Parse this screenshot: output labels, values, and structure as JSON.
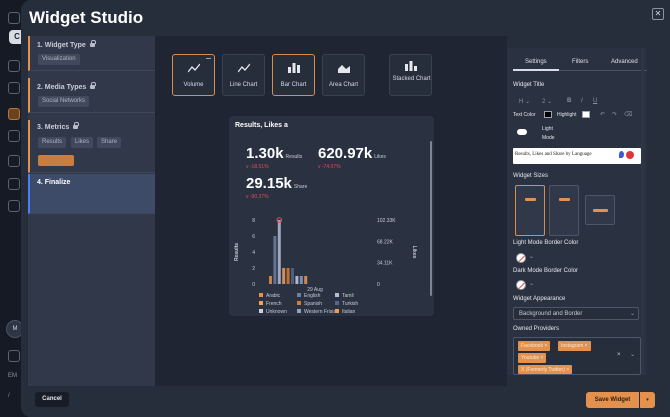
{
  "background_app": {
    "chip_letter": "C",
    "avatar_initials": "M",
    "footer_hint": "EM",
    "footer_hint2": "/"
  },
  "modal": {
    "title": "Widget Studio",
    "close_icon": "close-icon"
  },
  "steps": [
    {
      "title": "1. Widget Type",
      "locked": true,
      "tags": [
        "Visualization"
      ]
    },
    {
      "title": "2. Media Types",
      "locked": true,
      "tags": [
        "Social Networks"
      ]
    },
    {
      "title": "3. Metrics",
      "locked": true,
      "tags": [
        "Results",
        "Likes",
        "Share"
      ],
      "extra_tag": "Followers"
    },
    {
      "title": "4. Finalize",
      "locked": false,
      "tags": []
    }
  ],
  "chart_types": [
    {
      "label": "Volume",
      "icon": "line-chart-icon",
      "selected": true
    },
    {
      "label": "Line Chart",
      "icon": "line-chart-icon",
      "selected": false
    },
    {
      "label": "Bar Chart",
      "icon": "bar-chart-icon",
      "selected": true
    },
    {
      "label": "Area Chart",
      "icon": "area-chart-icon",
      "selected": false
    },
    {
      "label": "Stacked Chart",
      "icon": "stacked-chart-icon",
      "selected": false
    }
  ],
  "preview": {
    "title": "Results, Likes a",
    "metrics": [
      {
        "value": "1.30k",
        "label": "Results",
        "change": "v -18.51%"
      },
      {
        "value": "620.97k",
        "label": "Likes",
        "change": "v -74.07%"
      },
      {
        "value": "29.15k",
        "label": "Share",
        "change": "v -90.37%"
      }
    ],
    "legend": [
      "Arabic",
      "English",
      "Tamil",
      "French",
      "Spanish",
      "Turkish",
      "Unknown",
      "Western Frisian",
      "Italian"
    ],
    "legend_colors": [
      "#e3914d",
      "#6c7fa6",
      "#b3bdd6",
      "#f0a15c",
      "#d97b34",
      "#51678f",
      "#c7cfe0",
      "#8fa1c2",
      "#ee9b4f"
    ]
  },
  "chart_data": {
    "type": "bar",
    "title": "",
    "xlabel": "",
    "ylabel": "Results",
    "y2label": "Likes",
    "categories": [
      "29 Aug"
    ],
    "left_ticks": [
      "0",
      "2",
      "4",
      "6",
      "8"
    ],
    "right_ticks": [
      "0",
      "34.11K",
      "68.22K",
      "102.33K"
    ],
    "ylim": [
      0,
      8
    ],
    "y2lim": [
      0,
      102330
    ],
    "series": [
      {
        "name": "Arabic",
        "values": [
          1
        ]
      },
      {
        "name": "English",
        "values": [
          6
        ]
      },
      {
        "name": "Tamil",
        "values": [
          8
        ]
      },
      {
        "name": "French",
        "values": [
          2
        ]
      },
      {
        "name": "Spanish",
        "values": [
          2
        ]
      },
      {
        "name": "Turkish",
        "values": [
          2
        ]
      },
      {
        "name": "Unknown",
        "values": [
          1
        ]
      },
      {
        "name": "Western Frisian",
        "values": [
          1
        ]
      },
      {
        "name": "Italian",
        "values": [
          1
        ]
      }
    ]
  },
  "settings": {
    "tabs": [
      "Settings",
      "Filters",
      "Advanced"
    ],
    "active_tab": "Settings",
    "widget_title_label": "Widget Title",
    "toolbar": {
      "heading": "H",
      "size": "2",
      "bold": "B",
      "italic": "I",
      "underline": "U"
    },
    "text_color_label": "Text Color",
    "highlight_label": "Highlight",
    "light_mode_label": "Light Mode",
    "title_value": "Results, Likes and Share by Language",
    "widget_sizes_label": "Widget Sizes",
    "light_border_label": "Light Mode Border Color",
    "dark_border_label": "Dark Mode Border Color",
    "appearance_label": "Widget Appearance",
    "appearance_value": "Background and Border",
    "owned_providers_label": "Owned Providers",
    "providers": [
      "Facebook",
      "Instagram",
      "Youtube",
      "X (Formerly Twitter)"
    ]
  },
  "footer": {
    "cancel": "Cancel",
    "save": "Save Widget"
  },
  "colors": {
    "accent": "#e3914d",
    "selected_step": "#4c7dff",
    "negative": "#e0515a"
  }
}
